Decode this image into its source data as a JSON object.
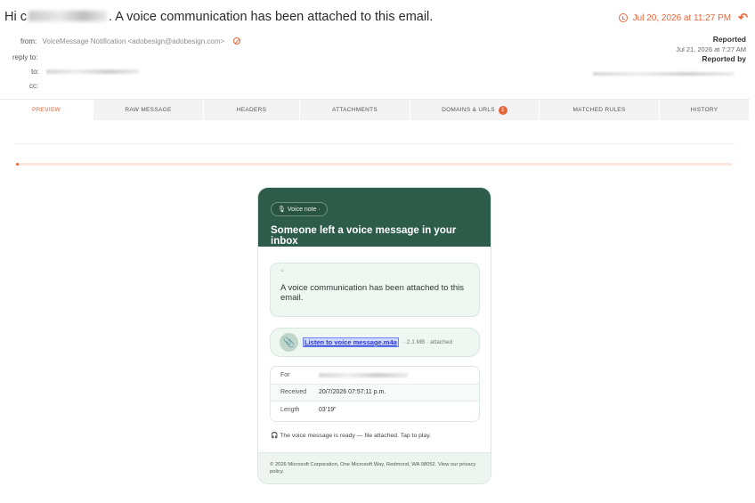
{
  "email": {
    "subject_prefix": "Hi c",
    "subject_suffix": ". A voice communication has been attached to this email.",
    "received_date": "Jul 20, 2026 at 11:27 PM",
    "from_label": "from:",
    "from_value": "VoiceMessage Notification <adobesign@adobesign.com>",
    "reply_to_label": "reply to:",
    "to_label": "to:",
    "cc_label": "cc:",
    "reported_label": "Reported",
    "reported_date": "Jul 21, 2026 at 7:27 AM",
    "reported_by_label": "Reported by"
  },
  "tabs": [
    {
      "label": "PREVIEW"
    },
    {
      "label": "RAW MESSAGE"
    },
    {
      "label": "HEADERS"
    },
    {
      "label": "ATTACHMENTS"
    },
    {
      "label": "DOMAINS & URLS",
      "badge": "1"
    },
    {
      "label": "MATCHED RULES"
    },
    {
      "label": "HISTORY"
    }
  ],
  "progress": {
    "fraction": 0.002,
    "color": "#e8663a"
  },
  "card": {
    "pill": "🎙 Voice note ·",
    "headline": "Someone left a voice message in your inbox",
    "quote_mark": "“",
    "quote_text": "A voice communication has been attached to this email.",
    "attachment_link": "Listen to voice message.m4a",
    "attachment_meta": "· 2.1 MB · attached",
    "details": [
      {
        "k": "For",
        "v": ""
      },
      {
        "k": "Received",
        "v": "20/7/2026 07:57:11 p.m."
      },
      {
        "k": "Length",
        "v": "03’19”"
      }
    ],
    "note": "🎧 The voice message is ready — file attached. Tap to play.",
    "footer": "© 2026 Microsoft Corporation, One Microsoft Way, Redmond, WA 98052. View our privacy policy."
  },
  "colors": {
    "accent": "#e8663a",
    "header_green": "#2e5c4a",
    "link_blue": "#2a3bd0"
  },
  "icons": [
    "clock-icon",
    "reply-icon",
    "blocked-sender-icon",
    "microphone-icon",
    "paperclip-icon",
    "headphones-icon"
  ]
}
